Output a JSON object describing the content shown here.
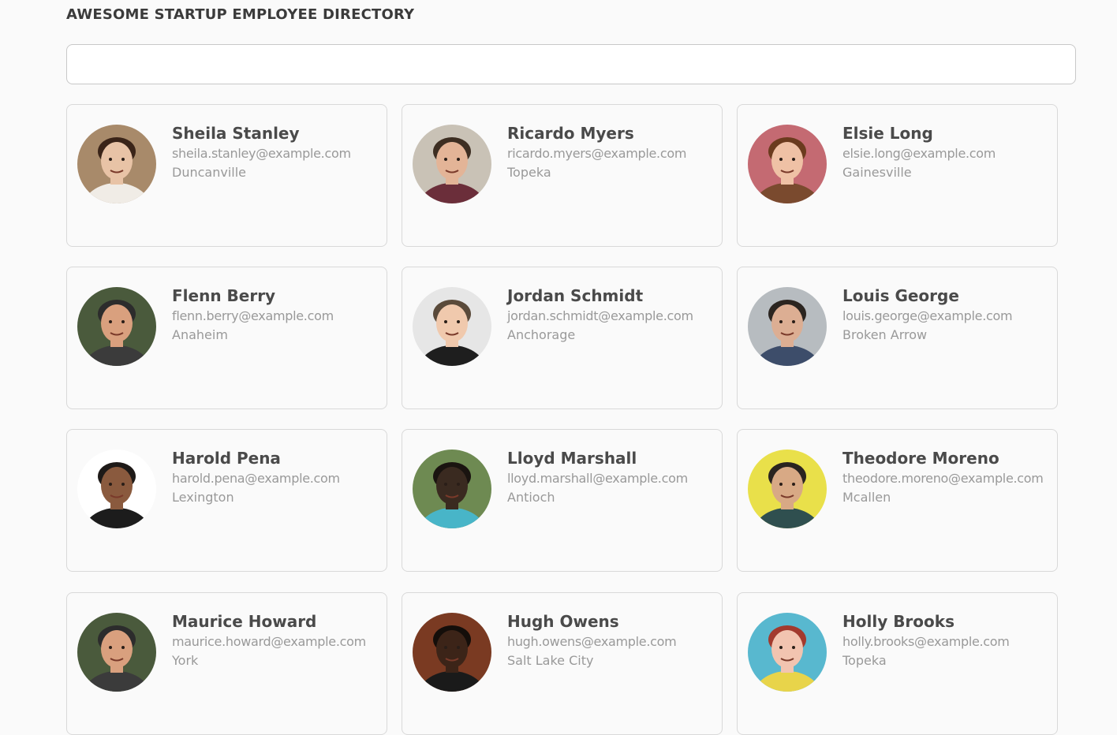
{
  "header": {
    "title": "AWESOME STARTUP EMPLOYEE DIRECTORY",
    "search_value": "",
    "search_placeholder": ""
  },
  "employees": [
    {
      "name": "Sheila Stanley",
      "email": "sheila.stanley@example.com",
      "city": "Duncanville",
      "bg": "#a88a6a",
      "skin": "#e8c3a6",
      "hair": "#3a2418",
      "shirt": "#f0ece6"
    },
    {
      "name": "Ricardo Myers",
      "email": "ricardo.myers@example.com",
      "city": "Topeka",
      "bg": "#c9c2b6",
      "skin": "#e3b497",
      "hair": "#3d2e22",
      "shirt": "#6b2e3a"
    },
    {
      "name": "Elsie Long",
      "email": "elsie.long@example.com",
      "city": "Gainesville",
      "bg": "#c46a72",
      "skin": "#efc1a5",
      "hair": "#6b3b1e",
      "shirt": "#7a4a2e"
    },
    {
      "name": "Flenn Berry",
      "email": "flenn.berry@example.com",
      "city": "Anaheim",
      "bg": "#4a5a3c",
      "skin": "#d9a07e",
      "hair": "#2c2c2c",
      "shirt": "#3b3b3b"
    },
    {
      "name": "Jordan Schmidt",
      "email": "jordan.schmidt@example.com",
      "city": "Anchorage",
      "bg": "#e6e6e6",
      "skin": "#f0c9ad",
      "hair": "#5a4a3a",
      "shirt": "#1e1e1e"
    },
    {
      "name": "Louis George",
      "email": "louis.george@example.com",
      "city": "Broken Arrow",
      "bg": "#b7bcc0",
      "skin": "#dcae93",
      "hair": "#2b2520",
      "shirt": "#3d4d6a"
    },
    {
      "name": "Harold Pena",
      "email": "harold.pena@example.com",
      "city": "Lexington",
      "bg": "#ffffff",
      "skin": "#8a5a3e",
      "hair": "#1e1a18",
      "shirt": "#1c1c1c"
    },
    {
      "name": "Lloyd Marshall",
      "email": "lloyd.marshall@example.com",
      "city": "Antioch",
      "bg": "#6e8a52",
      "skin": "#3a2a20",
      "hair": "#1a1410",
      "shirt": "#48b5c8"
    },
    {
      "name": "Theodore Moreno",
      "email": "theodore.moreno@example.com",
      "city": "Mcallen",
      "bg": "#e9e04a",
      "skin": "#d8a985",
      "hair": "#2a2420",
      "shirt": "#2f4f4f"
    },
    {
      "name": "Maurice Howard",
      "email": "maurice.howard@example.com",
      "city": "York",
      "bg": "#4a5a3c",
      "skin": "#d9a07e",
      "hair": "#2c2c2c",
      "shirt": "#3b3b3b"
    },
    {
      "name": "Hugh Owens",
      "email": "hugh.owens@example.com",
      "city": "Salt Lake City",
      "bg": "#7a3a22",
      "skin": "#3c2418",
      "hair": "#140e0a",
      "shirt": "#1a1a1a"
    },
    {
      "name": "Holly Brooks",
      "email": "holly.brooks@example.com",
      "city": "Topeka",
      "bg": "#58b8cf",
      "skin": "#f2c4b0",
      "hair": "#a23a2e",
      "shirt": "#e8d44a"
    }
  ]
}
